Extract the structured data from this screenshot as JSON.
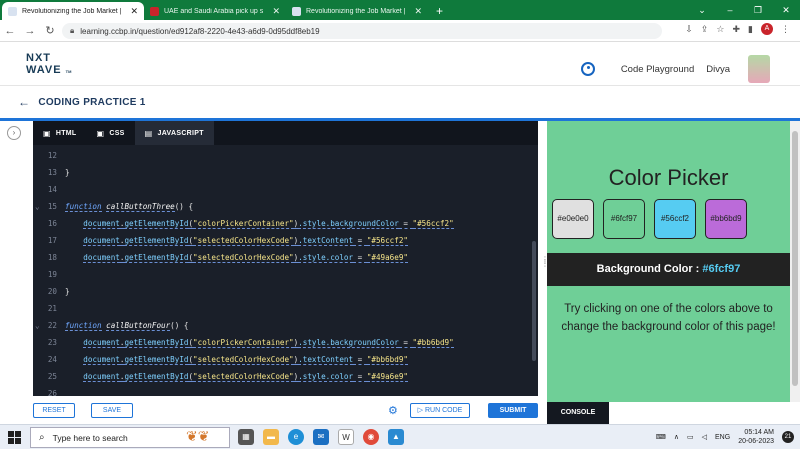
{
  "browser": {
    "tabs": [
      {
        "title": "Revolutionizing the Job Market |",
        "active": true
      },
      {
        "title": "UAE and Saudi Arabia pick up s",
        "active": false
      },
      {
        "title": "Revolutionizing the Job Market |",
        "active": false
      }
    ],
    "url": "learning.ccbp.in/question/ed912af8-2220-4e43-a6d9-0d95ddf8eb19",
    "profile_initial": "A"
  },
  "header": {
    "logo_line1": "NXT",
    "logo_line2": "WAVE",
    "logo_tm": "TM",
    "code_playground": "Code Playground",
    "user_name": "Divya"
  },
  "practice": {
    "title": "CODING PRACTICE 1"
  },
  "editor": {
    "tabs": [
      {
        "label": "HTML",
        "active": false
      },
      {
        "label": "CSS",
        "active": false
      },
      {
        "label": "JAVASCRIPT",
        "active": true
      }
    ],
    "lines": [
      {
        "n": "12",
        "text": ""
      },
      {
        "n": "13",
        "text": "}"
      },
      {
        "n": "14",
        "text": ""
      },
      {
        "n": "15",
        "fold": true,
        "kind": "func",
        "name": "callButtonThree"
      },
      {
        "n": "16",
        "kind": "stmt",
        "id": "\"colorPickerContainer\"",
        "tail": ".style.backgroundColor",
        "val": "\"#56ccf2\""
      },
      {
        "n": "17",
        "kind": "stmt",
        "id": "\"selectedColorHexCode\"",
        "tail": ".textContent",
        "val": "\"#56ccf2\""
      },
      {
        "n": "18",
        "kind": "stmt",
        "id": "\"selectedColorHexCode\"",
        "tail": ".style.color",
        "val": "\"#49a6e9\""
      },
      {
        "n": "19",
        "text": ""
      },
      {
        "n": "20",
        "text": "}"
      },
      {
        "n": "21",
        "text": ""
      },
      {
        "n": "22",
        "fold": true,
        "kind": "func",
        "name": "callButtonFour"
      },
      {
        "n": "23",
        "kind": "stmt",
        "id": "\"colorPickerContainer\"",
        "tail": ".style.backgroundColor",
        "val": "\"#bb6bd9\""
      },
      {
        "n": "24",
        "kind": "stmt",
        "id": "\"selectedColorHexCode\"",
        "tail": ".textContent",
        "val": "\"#bb6bd9\""
      },
      {
        "n": "25",
        "kind": "stmt",
        "id": "\"selectedColorHexCode\"",
        "tail": ".style.color",
        "val": "\"#49a6e9\""
      },
      {
        "n": "26",
        "text": ""
      }
    ],
    "buttons": {
      "reset": "RESET",
      "save": "SAVE",
      "run": "RUN CODE",
      "submit": "SUBMIT"
    }
  },
  "preview": {
    "title": "Color Picker",
    "background": "#6fcf97",
    "swatches": [
      {
        "label": "#e0e0e0",
        "color": "#e0e0e0"
      },
      {
        "label": "#6fcf97",
        "color": "#6fcf97"
      },
      {
        "label": "#56ccf2",
        "color": "#56ccf2"
      },
      {
        "label": "#bb6bd9",
        "color": "#bb6bd9"
      }
    ],
    "bg_label": "Background Color : ",
    "bg_value": "#6fcf97",
    "hint": "Try clicking on one of the colors above to change the background color of this page!",
    "console_tab": "CONSOLE"
  },
  "taskbar": {
    "search_placeholder": "Type here to search",
    "lang": "ENG",
    "time": "05:14 AM",
    "date": "20-06-2023",
    "notifications": "21"
  },
  "colors": {
    "accent": "#1e74d8",
    "tabbar": "#0f7a3c"
  }
}
